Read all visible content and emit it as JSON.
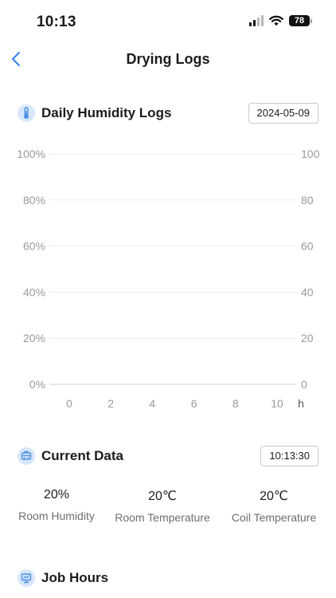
{
  "status_bar": {
    "time": "10:13",
    "battery": "78"
  },
  "nav": {
    "title": "Drying Logs",
    "back_icon": "chevron-left-icon"
  },
  "humidity_section": {
    "title": "Daily Humidity Logs",
    "icon": "thermometer-icon",
    "date": "2024-05-09"
  },
  "chart_data": {
    "type": "line",
    "x": [],
    "series": [],
    "xlim": [
      0,
      10
    ],
    "ylim": [
      0,
      100
    ],
    "x_ticks": [
      "0",
      "2",
      "4",
      "6",
      "8",
      "10"
    ],
    "x_unit": "h",
    "y_left_ticks": [
      "0%",
      "20%",
      "40%",
      "60%",
      "80%",
      "100%"
    ],
    "y_right_ticks": [
      "0",
      "20",
      "40",
      "60",
      "80",
      "100"
    ],
    "grid": true,
    "colors": {
      "grid": "#ececec",
      "axis": "#cfcfcf",
      "tick": "#9a9a9e"
    }
  },
  "current_section": {
    "title": "Current Data",
    "icon": "device-icon",
    "time": "10:13:30",
    "metrics": [
      {
        "value": "20%",
        "label": "Room Humidity"
      },
      {
        "value": "20℃",
        "label": "Room Temperature"
      },
      {
        "value": "20℃",
        "label": "Coil Temperature"
      }
    ]
  },
  "job_section": {
    "title": "Job Hours",
    "icon": "presentation-icon"
  },
  "colors": {
    "accent": "#2f80ed",
    "icon_bg": "#d7e7fb",
    "icon_fg": "#4a90e2"
  }
}
